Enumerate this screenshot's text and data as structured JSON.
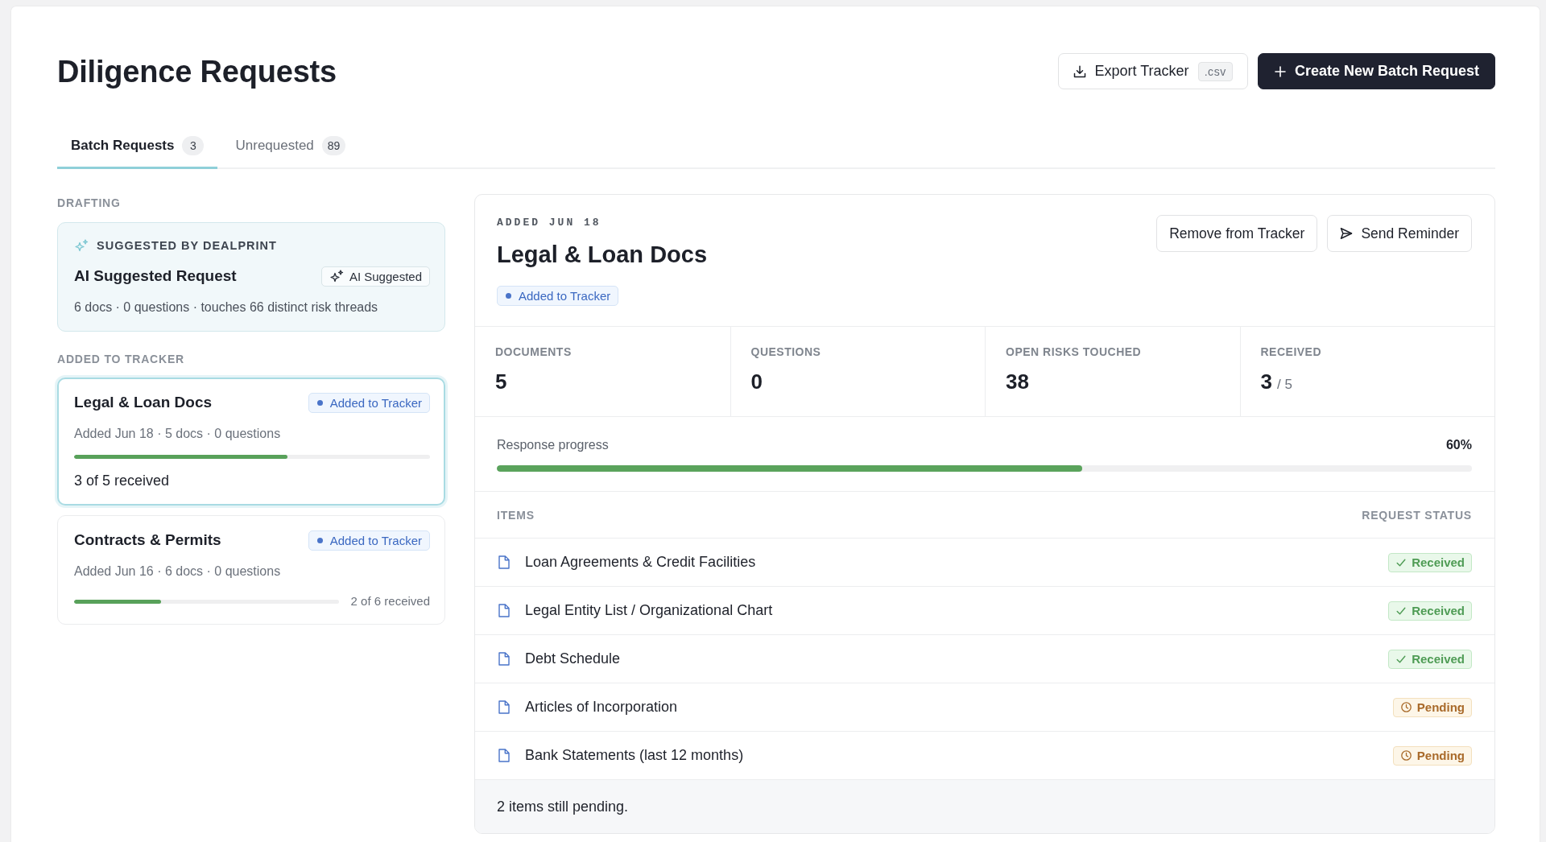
{
  "page": {
    "title": "Diligence Requests"
  },
  "actions": [
    {
      "kind": "export",
      "label": "Export Tracker",
      "tag": ".csv"
    },
    {
      "kind": "create",
      "label": "Create New Batch Request"
    }
  ],
  "tabs": [
    {
      "label": "Batch Requests",
      "count": "3",
      "selected": true
    },
    {
      "label": "Unrequested",
      "count": "89",
      "selected": false
    }
  ],
  "sidebar": {
    "sections": [
      {
        "heading": "DRAFTING",
        "cards": [
          {
            "kind": "suggestion",
            "selected": false,
            "eyebrow": "SUGGESTED BY DEALPRINT",
            "title": "AI Suggested Request",
            "badge": "AI Suggested",
            "meta": "6 docs · 0 questions · touches 66 distinct risk threads"
          }
        ]
      },
      {
        "heading": "ADDED TO TRACKER",
        "cards": [
          {
            "kind": "batch",
            "selected": true,
            "title": "Legal & Loan Docs",
            "badge": "Added to Tracker",
            "meta": "Added Jun 18 · 5 docs · 0 questions",
            "level": 0.6,
            "progress_label": "3 of 5 received"
          },
          {
            "kind": "batch",
            "selected": false,
            "title": "Contracts & Permits",
            "badge": "Added to Tracker",
            "meta": "Added Jun 16 · 6 docs · 0 questions",
            "level": 0.33,
            "progress_label": "2 of 6 received"
          }
        ]
      }
    ]
  },
  "detail": {
    "eyebrow": "ADDED JUN 18",
    "title": "Legal & Loan Docs",
    "badge": "Added to Tracker",
    "actions": [
      {
        "kind": "remove",
        "label": "Remove from Tracker"
      },
      {
        "kind": "remind",
        "label": "Send Reminder"
      }
    ],
    "stats": [
      {
        "label": "DOCUMENTS",
        "value": "5"
      },
      {
        "label": "QUESTIONS",
        "value": "0"
      },
      {
        "label": "OPEN RISKS TOUCHED",
        "value": "38"
      },
      {
        "label": "RECEIVED",
        "value": "3",
        "total": "/ 5"
      }
    ],
    "progress": {
      "label": "Response progress",
      "reading": "60%",
      "level": 0.6
    },
    "table": {
      "columns": [
        "ITEMS",
        "REQUEST STATUS"
      ],
      "rows": [
        {
          "name": "Loan Agreements & Credit Facilities",
          "kind": "received",
          "status": "Received"
        },
        {
          "name": "Legal Entity List / Organizational Chart",
          "kind": "received",
          "status": "Received"
        },
        {
          "name": "Debt Schedule",
          "kind": "received",
          "status": "Received"
        },
        {
          "name": "Articles of Incorporation",
          "kind": "pending",
          "status": "Pending"
        },
        {
          "name": "Bank Statements (last 12 months)",
          "kind": "pending",
          "status": "Pending"
        }
      ]
    },
    "footer": "2 items still pending."
  }
}
